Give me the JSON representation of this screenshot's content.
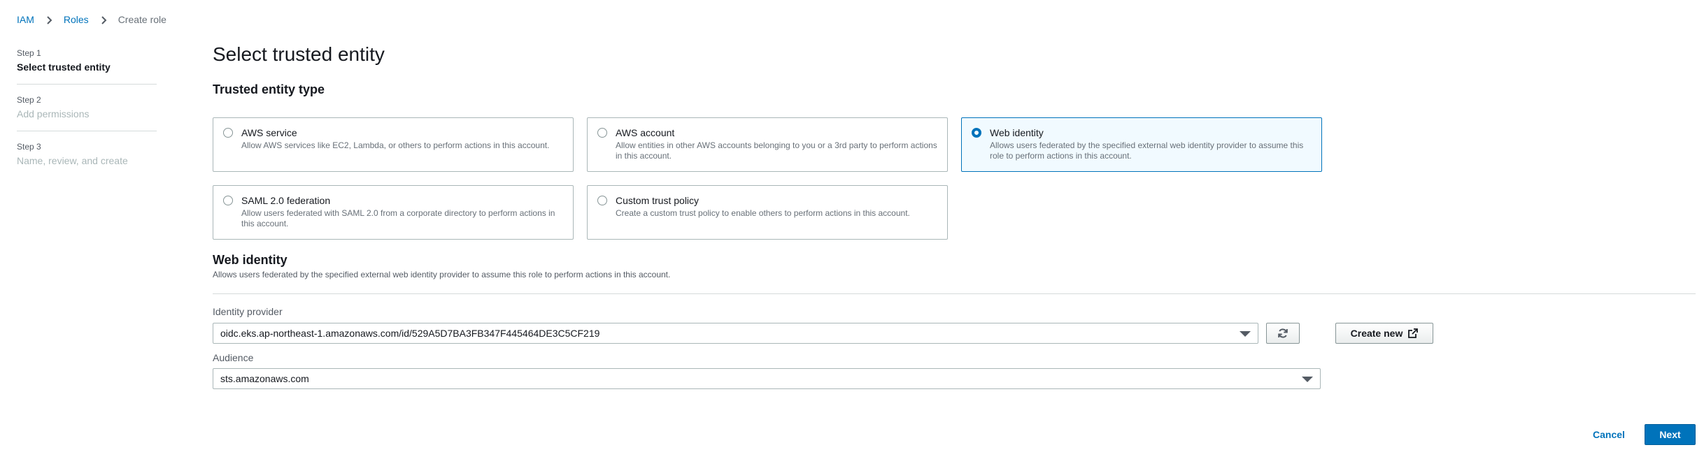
{
  "breadcrumb": {
    "items": [
      "IAM",
      "Roles"
    ],
    "current": "Create role"
  },
  "steps": [
    {
      "num": "Step 1",
      "title": "Select trusted entity"
    },
    {
      "num": "Step 2",
      "title": "Add permissions"
    },
    {
      "num": "Step 3",
      "title": "Name, review, and create"
    }
  ],
  "page_title": "Select trusted entity",
  "entity_section_title": "Trusted entity type",
  "entity_types": [
    {
      "label": "AWS service",
      "description": "Allow AWS services like EC2, Lambda, or others to perform actions in this account.",
      "selected": false
    },
    {
      "label": "AWS account",
      "description": "Allow entities in other AWS accounts belonging to you or a 3rd party to perform actions in this account.",
      "selected": false
    },
    {
      "label": "Web identity",
      "description": "Allows users federated by the specified external web identity provider to assume this role to perform actions in this account.",
      "selected": true
    },
    {
      "label": "SAML 2.0 federation",
      "description": "Allow users federated with SAML 2.0 from a corporate directory to perform actions in this account.",
      "selected": false
    },
    {
      "label": "Custom trust policy",
      "description": "Create a custom trust policy to enable others to perform actions in this account.",
      "selected": false
    }
  ],
  "web_identity": {
    "title": "Web identity",
    "description": "Allows users federated by the specified external web identity provider to assume this role to perform actions in this account.",
    "identity_provider_label": "Identity provider",
    "identity_provider_value": "oidc.eks.ap-northeast-1.amazonaws.com/id/529A5D7BA3FB347F445464DE3C5CF219",
    "create_new_label": "Create new",
    "audience_label": "Audience",
    "audience_value": "sts.amazonaws.com"
  },
  "footer": {
    "cancel_label": "Cancel",
    "next_label": "Next"
  },
  "colors": {
    "accent": "#0073bb",
    "selected_bg": "#f1faff",
    "border": "#aab7b8"
  }
}
